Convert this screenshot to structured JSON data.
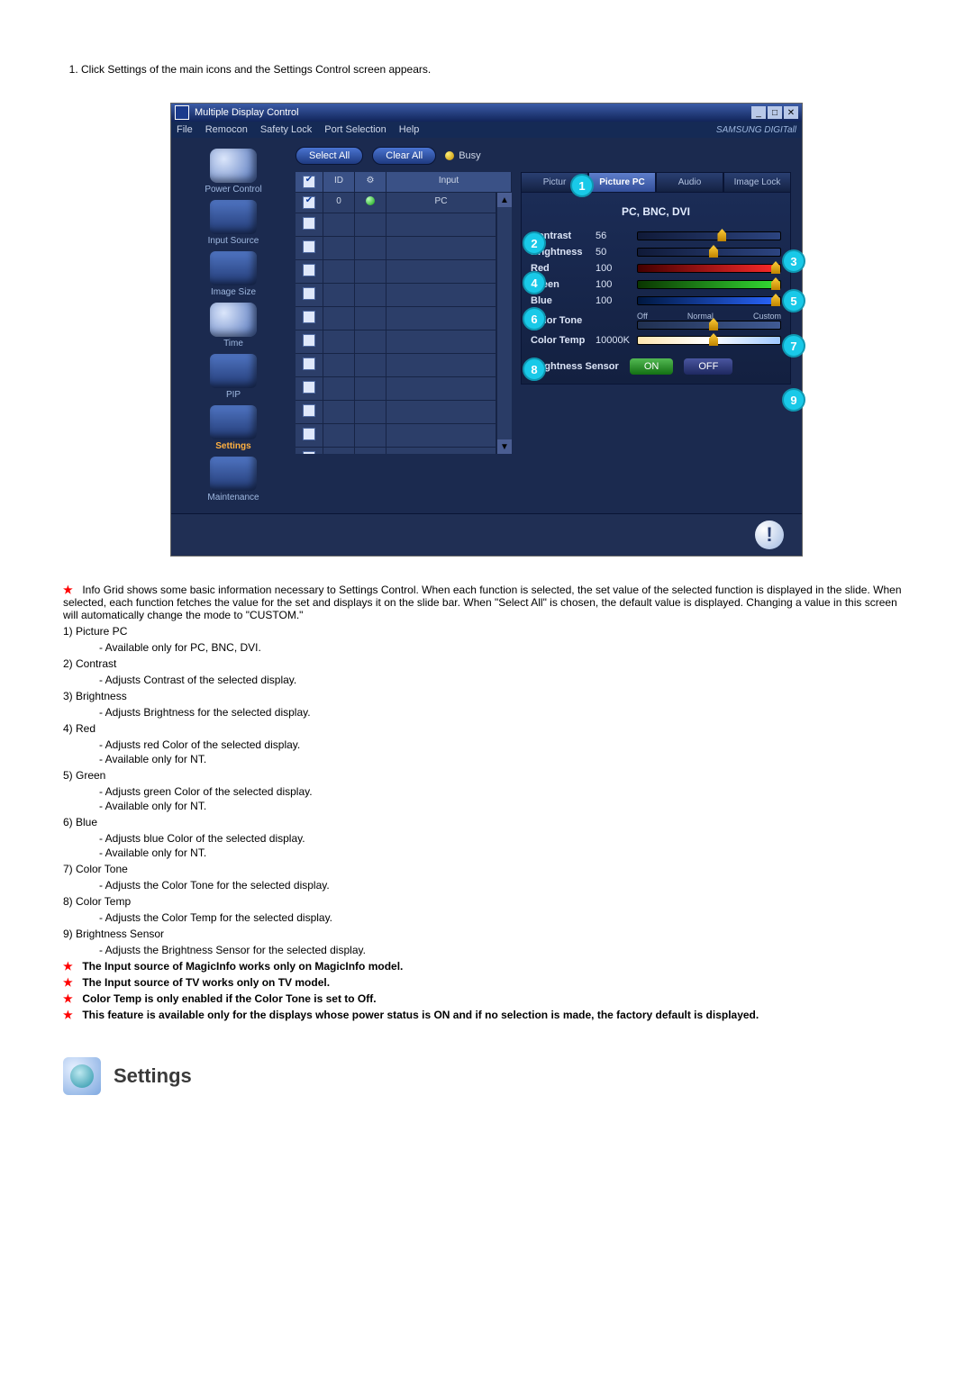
{
  "instruction": {
    "num": "1.",
    "text": "Click Settings of the main icons and the Settings Control screen appears."
  },
  "window": {
    "title": "Multiple Display Control",
    "menus": [
      "File",
      "Remocon",
      "Safety Lock",
      "Port Selection",
      "Help"
    ],
    "logo": "SAMSUNG DIGITall"
  },
  "sidebar": {
    "items": [
      {
        "label": "Power Control"
      },
      {
        "label": "Input Source"
      },
      {
        "label": "Image Size"
      },
      {
        "label": "Time"
      },
      {
        "label": "PIP"
      },
      {
        "label": "Settings",
        "active": true
      },
      {
        "label": "Maintenance"
      }
    ]
  },
  "buttons": {
    "select_all": "Select All",
    "clear_all": "Clear All",
    "busy": "Busy"
  },
  "grid": {
    "header": {
      "chk": "☑",
      "id": "ID",
      "status": "⚙",
      "input": "Input"
    },
    "row1": {
      "id": "0",
      "input": "PC"
    }
  },
  "tabs": {
    "t1": "Pictur",
    "t2": "Picture PC",
    "t3": "Audio",
    "t4": "Image Lock"
  },
  "panel": {
    "header": "PC, BNC, DVI",
    "contrast": {
      "label": "Contrast",
      "value": "56"
    },
    "brightness": {
      "label": "Brightness",
      "value": "50"
    },
    "red": {
      "label": "Red",
      "value": "100"
    },
    "green": {
      "label": "Green",
      "value": "100"
    },
    "blue": {
      "label": "Blue",
      "value": "100"
    },
    "tone": {
      "label": "Color Tone",
      "opts": {
        "off": "Off",
        "normal": "Normal",
        "custom": "Custom"
      }
    },
    "temp": {
      "label": "Color Temp",
      "value": "10000K"
    },
    "bsensor": {
      "label": "Brightness Sensor",
      "on": "ON",
      "off": "OFF"
    }
  },
  "callouts": {
    "c1": "1",
    "c2": "2",
    "c3": "3",
    "c4": "4",
    "c5": "5",
    "c6": "6",
    "c7": "7",
    "c8": "8",
    "c9": "9"
  },
  "notes": {
    "intro": "Info Grid shows some basic information necessary to Settings Control. When each function is selected, the set value of the selected function is displayed in the slide. When selected, each function fetches the value for the set and displays it on the slide bar. When \"Select All\" is chosen, the default value is displayed. Changing a value in this screen will automatically change the mode to \"CUSTOM.\"",
    "n1": {
      "h": "1)  Picture PC",
      "a": "- Available only for PC, BNC, DVI."
    },
    "n2": {
      "h": "2)  Contrast",
      "a": "- Adjusts Contrast of the selected display."
    },
    "n3": {
      "h": "3)  Brightness",
      "a": "- Adjusts Brightness for the selected display."
    },
    "n4": {
      "h": "4)  Red",
      "a": "- Adjusts red Color of the selected display.",
      "b": "- Available  only for NT."
    },
    "n5": {
      "h": "5)  Green",
      "a": "- Adjusts green Color of the selected display.",
      "b": "- Available  only for NT."
    },
    "n6": {
      "h": "6)  Blue",
      "a": "- Adjusts blue Color of the selected display.",
      "b": "- Available  only for NT."
    },
    "n7": {
      "h": "7)  Color Tone",
      "a": "- Adjusts the Color Tone for the selected display."
    },
    "n8": {
      "h": "8)  Color Temp",
      "a": "- Adjusts the Color Temp for the selected display."
    },
    "n9": {
      "h": "9)  Brightness Sensor",
      "a": "- Adjusts the Brightness Sensor for the selected display."
    },
    "s1": "The Input source of MagicInfo works only on MagicInfo model.",
    "s2": "The Input source of TV works only on TV model.",
    "s3": "Color Temp is only enabled if the Color Tone is set to Off.",
    "s4": "This feature is available only for the displays whose power status is ON and if no selection is made, the factory default is displayed."
  },
  "footer_heading": "Settings"
}
